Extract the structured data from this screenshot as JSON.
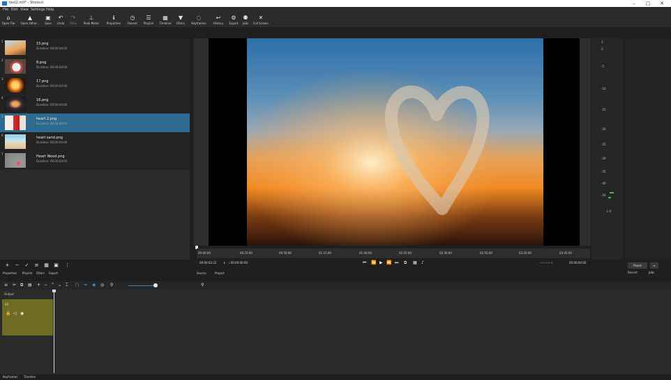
{
  "window": {
    "title": "test2.mlt* - Shotcut",
    "minimize": "–",
    "maximize": "□",
    "close": "✕"
  },
  "menu": [
    "File",
    "Edit",
    "View",
    "Settings",
    "Help"
  ],
  "toolbar": [
    {
      "label": "Open File",
      "icon": "⌂"
    },
    {
      "label": "Open Other...",
      "icon": "▲"
    },
    {
      "label": "Save",
      "icon": "▣"
    },
    {
      "label": "Undo",
      "icon": "↶"
    },
    {
      "label": "Redo",
      "icon": "↷"
    },
    {
      "label": "Peak Meter",
      "icon": "⊥"
    },
    {
      "label": "Properties",
      "icon": "ℹ"
    },
    {
      "label": "Recent",
      "icon": "◷"
    },
    {
      "label": "Playlist",
      "icon": "☰"
    },
    {
      "label": "Timeline",
      "icon": "▦"
    },
    {
      "label": "Filters",
      "icon": "▼"
    },
    {
      "label": "Keyframes",
      "icon": "◌"
    },
    {
      "label": "History",
      "icon": "↩"
    },
    {
      "label": "Export",
      "icon": "⚙"
    },
    {
      "label": "Jobs",
      "icon": "⚉"
    },
    {
      "label": "Full Screen",
      "icon": "✕"
    }
  ],
  "playlist": {
    "items": [
      {
        "num": "1",
        "name": "15.png",
        "duration": "Duration: 00:00:04:00"
      },
      {
        "num": "2",
        "name": "8.png",
        "duration": "Duration: 00:00:04:00"
      },
      {
        "num": "3",
        "name": "17.png",
        "duration": "Duration: 00:00:04:00"
      },
      {
        "num": "4",
        "name": "16.png",
        "duration": "Duration: 00:00:04:00"
      },
      {
        "num": "5",
        "name": "heart 2.png",
        "duration": "Duration: 00:00:04:00"
      },
      {
        "num": "6",
        "name": "heart sand.png",
        "duration": "Duration: 00:00:04:00"
      },
      {
        "num": "7",
        "name": "Heart Wood.png",
        "duration": "Duration: 00:00:04:00"
      }
    ],
    "selected_index": 4,
    "tabs": [
      "Properties",
      "Playlist",
      "Filters",
      "Export"
    ]
  },
  "ruler": [
    "00:00:00",
    "00:25:00",
    "00:50:00",
    "01:15:00",
    "01:40:00",
    "02:05:00",
    "02:30:00",
    "02:55:00",
    "03:20:00",
    "03:45:00"
  ],
  "transport": {
    "position": "00:00:03:22",
    "total": "/ 00:00:00:00",
    "in_out": "--:--:--:-- /",
    "duration_right": "00:00:04:00"
  },
  "source_tabs": [
    "Source",
    "Project"
  ],
  "meter": {
    "levels": [
      "3",
      "0",
      "-5",
      "-10",
      "-15",
      "-20",
      "-25",
      "-30",
      "-35",
      "-40",
      "-50"
    ],
    "channels": "L R"
  },
  "side": {
    "pause": "Pause",
    "tabs": [
      "Recent",
      "Jobs"
    ]
  },
  "timeline": {
    "output_label": "Output",
    "track_label": "V1"
  },
  "bottom_tabs": [
    "Keyframes",
    "Timeline"
  ],
  "colors": {
    "selection": "#2d6a8f",
    "track": "#6f6b23",
    "accent": "#3b7fc4"
  }
}
